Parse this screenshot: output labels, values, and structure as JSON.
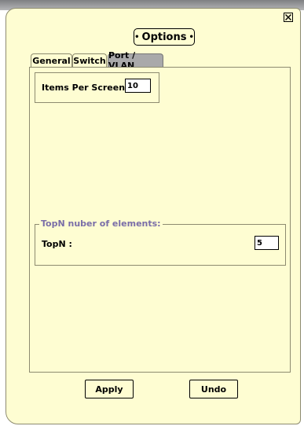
{
  "dialog": {
    "title": "Options",
    "close_icon": "close-x-icon"
  },
  "tabs": [
    {
      "label": "General",
      "active": true
    },
    {
      "label": "Switch",
      "active": false
    },
    {
      "label": "Port / VLAN",
      "active": false
    }
  ],
  "general": {
    "items_per_screen_label": "Items Per Screen :",
    "items_per_screen_value": "10",
    "topn_group_title": "TopN nuber of elements:",
    "topn_label": "TopN :",
    "topn_value": "5"
  },
  "buttons": {
    "apply_label": "Apply",
    "undo_label": "Undo"
  },
  "colors": {
    "dialog_background": "#fefdd2",
    "inactive_tab": "#a9a9aa",
    "group_title": "#7a6ea8"
  }
}
